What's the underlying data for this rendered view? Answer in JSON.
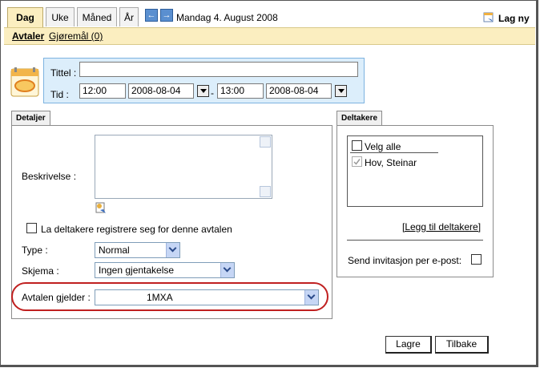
{
  "tabs": [
    {
      "label": "Dag",
      "active": true
    },
    {
      "label": "Uke"
    },
    {
      "label": "Måned"
    },
    {
      "label": "År"
    }
  ],
  "date_label": "Mandag 4. August 2008",
  "new_label": "Lag ny",
  "subnav": {
    "avtaler": "Avtaler",
    "gjoremal": "Gjøremål (0)"
  },
  "form": {
    "title_label": "Tittel :",
    "title_value": "",
    "time_label": "Tid :",
    "start_time": "12:00",
    "start_date": "2008-08-04",
    "separator": "-",
    "end_time": "13:00",
    "end_date": "2008-08-04"
  },
  "details": {
    "tab_label": "Detaljer",
    "description_label": "Beskrivelse :",
    "register_label": "La deltakere registrere seg for denne avtalen",
    "type_label": "Type :",
    "type_value": "Normal",
    "schema_label": "Skjema :",
    "schema_value": "Ingen gjentakelse",
    "applies_label": "Avtalen gjelder :",
    "applies_value": "1MXA"
  },
  "participants": {
    "tab_label": "Deltakere",
    "select_all": "Velg alle",
    "items": [
      "Hov, Steinar"
    ],
    "add_link": "[Legg til deltakere]",
    "invite_label": "Send invitasjon per e-post:"
  },
  "buttons": {
    "save": "Lagre",
    "back": "Tilbake"
  },
  "colors": {
    "tab_active": "#fbeec0",
    "form_box": "#dceefb",
    "highlight_ellipse": "#c02020"
  }
}
